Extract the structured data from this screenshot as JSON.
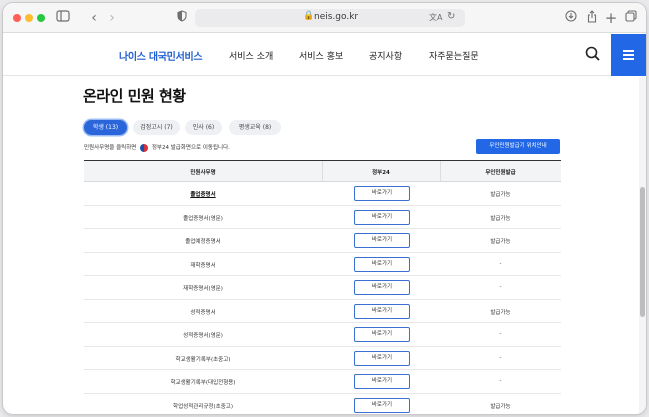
{
  "browser": {
    "url": "neis.go.kr"
  },
  "site": {
    "logo": "나이스 대국민서비스",
    "nav": [
      "서비스 소개",
      "서비스 홍보",
      "공지사항",
      "자주묻는질문"
    ]
  },
  "page": {
    "title": "온라인 민원 현황",
    "tabs": [
      {
        "label": "학생 (13)",
        "active": true
      },
      {
        "label": "검정고시 (7)",
        "active": false
      },
      {
        "label": "인사 (6)",
        "active": false
      },
      {
        "label": "평생교육 (8)",
        "active": false
      }
    ],
    "notice_prefix": "민원사무명을 클릭하면",
    "notice_suffix": "정부24 발급화면으로 이동됩니다.",
    "guide_button": "무인민원발급기 위치안내"
  },
  "table": {
    "headers": [
      "민원사무명",
      "정부24",
      "무인민원발급"
    ],
    "go_label": "바로가기",
    "rows": [
      {
        "name": "졸업증명서",
        "kiosk": "발급가능",
        "bold": true
      },
      {
        "name": "졸업증명서(영문)",
        "kiosk": "발급가능",
        "bold": false
      },
      {
        "name": "졸업예정증명서",
        "kiosk": "발급가능",
        "bold": false
      },
      {
        "name": "재학증명서",
        "kiosk": "-",
        "bold": false
      },
      {
        "name": "재학증명서(영문)",
        "kiosk": "-",
        "bold": false
      },
      {
        "name": "성적증명서",
        "kiosk": "발급가능",
        "bold": false
      },
      {
        "name": "성적증명서(영문)",
        "kiosk": "-",
        "bold": false
      },
      {
        "name": "학교생활기록부(초중고)",
        "kiosk": "-",
        "bold": false
      },
      {
        "name": "학교생활기록부(대입전형용)",
        "kiosk": "-",
        "bold": false
      },
      {
        "name": "학업성적관리규정(초중고)",
        "kiosk": "발급가능",
        "bold": false
      }
    ]
  }
}
